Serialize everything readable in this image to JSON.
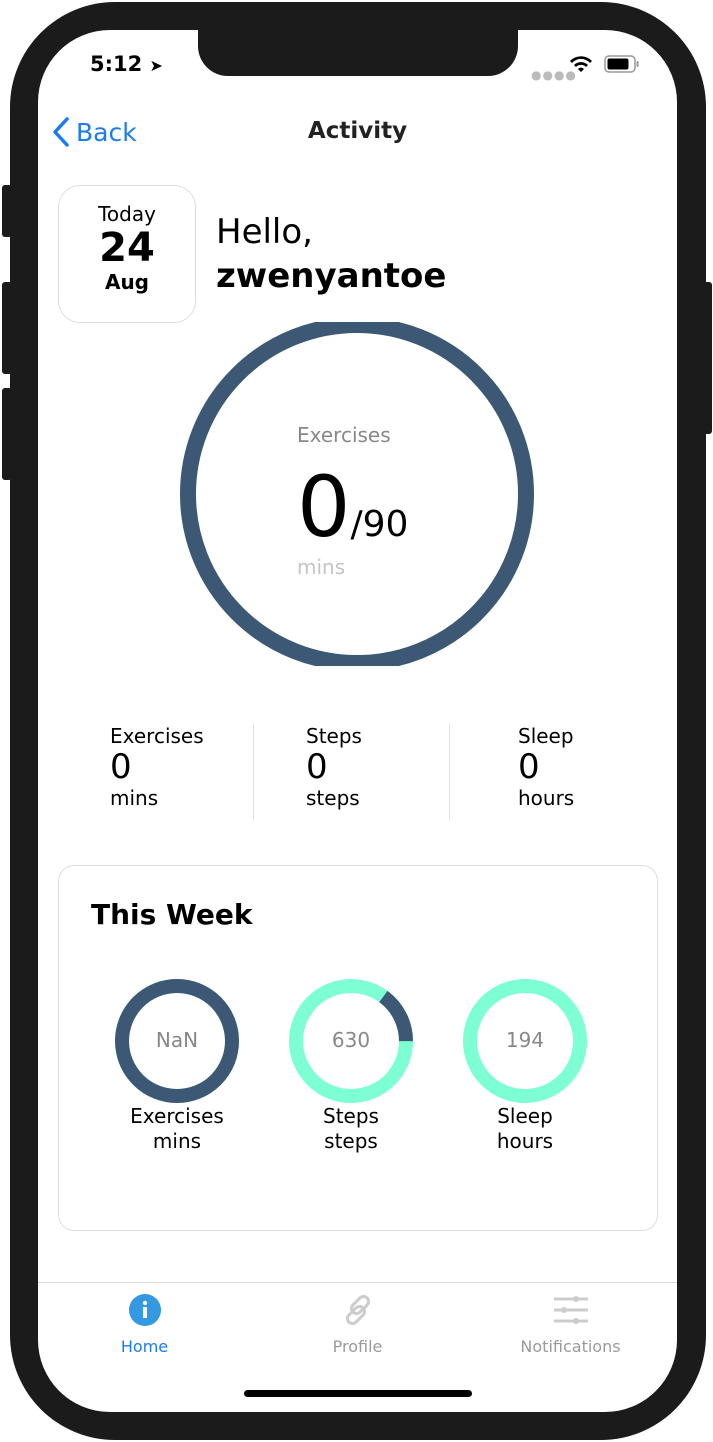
{
  "status_bar": {
    "time": "5:12"
  },
  "nav": {
    "back_label": "Back",
    "title": "Activity"
  },
  "date": {
    "label": "Today",
    "day": "24",
    "month": "Aug"
  },
  "greeting": {
    "hello": "Hello,",
    "username": "zwenyantoe"
  },
  "main_ring": {
    "label": "Exercises",
    "value": "0",
    "goal": "/90",
    "unit": "mins",
    "progress": 0,
    "color": "#3d5875"
  },
  "stats": [
    {
      "label": "Exercises",
      "value": "0",
      "unit": "mins"
    },
    {
      "label": "Steps",
      "value": "0",
      "unit": "steps"
    },
    {
      "label": "Sleep",
      "value": "0",
      "unit": "hours"
    }
  ],
  "week": {
    "title": "This Week",
    "rings": [
      {
        "value": "NaN",
        "label": "Exercises",
        "unit": "mins",
        "dark_fraction": 1
      },
      {
        "value": "630",
        "label": "Steps",
        "unit": "steps",
        "dark_fraction": 0.15
      },
      {
        "value": "194",
        "label": "Sleep",
        "unit": "hours",
        "dark_fraction": 0
      }
    ],
    "colors": {
      "dark": "#3d5875",
      "light": "#7effd3"
    }
  },
  "tabs": [
    {
      "label": "Home",
      "icon": "info-icon",
      "active": true
    },
    {
      "label": "Profile",
      "icon": "link-icon"
    },
    {
      "label": "Notifications",
      "icon": "sliders-icon"
    }
  ],
  "colors": {
    "accent": "#1a7cf2",
    "tab_active": "#3399e0",
    "tab_inactive": "#9a9a9a"
  }
}
